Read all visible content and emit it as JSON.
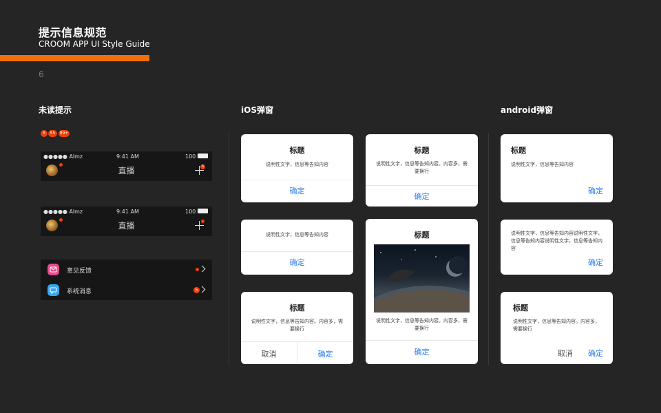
{
  "header": {
    "title": "提示信息规范",
    "subtitle": "CROOM APP UI Style Guide",
    "page_number": "6"
  },
  "colors": {
    "background": "#252525",
    "accent_orange": "#f36f0a",
    "badge_red": "#f0410b",
    "link_blue": "#2a7ff5"
  },
  "sections": {
    "unread": "未读提示",
    "ios": "iOS弹窗",
    "android": "android弹窗"
  },
  "badges": [
    "5",
    "55",
    "99+"
  ],
  "phone_bar": {
    "carrier": "●●●●● Almz",
    "time": "9:41 AM",
    "battery": "100",
    "nav_title": "直播",
    "plus_badge": "5"
  },
  "messages": [
    {
      "label": "意见反馈",
      "icon": "mail-icon",
      "color": "#e94b8c"
    },
    {
      "label": "系统消息",
      "icon": "chat-icon",
      "color": "#36a8f4",
      "badge": "5"
    }
  ],
  "ios_dialogs": {
    "title": "标题",
    "body_short": "说明性文字，信息等告知内容",
    "body_long": "说明性文字，信息等告知内容。内容多，需要换行",
    "confirm": "确定",
    "cancel": "取消"
  },
  "android_dialogs": {
    "title": "标题",
    "body_short": "说明性文字，信息等告知内容",
    "body_no_title": "说明性文字，信息等告知内容说明性文字，信息等告知内容说明性文字，信息等告知内容",
    "body_long": "说明性文字，信息等告知内容。内容多，需要换行",
    "confirm": "确定",
    "cancel": "取消"
  }
}
